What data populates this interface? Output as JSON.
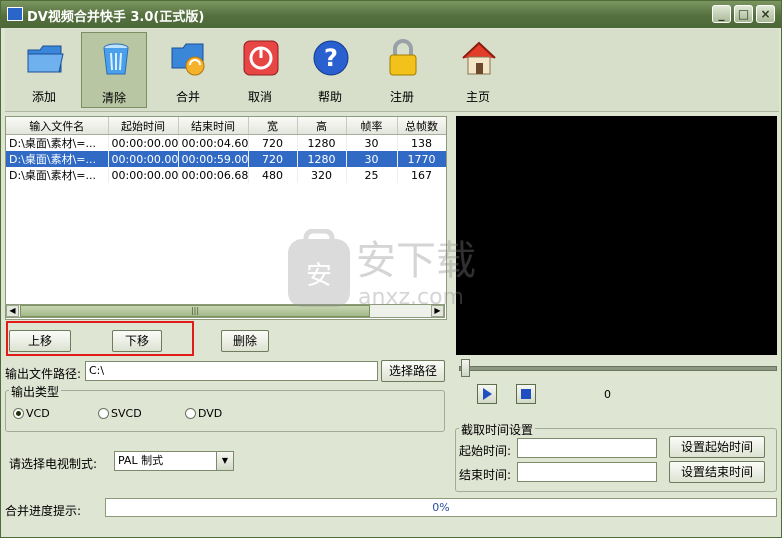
{
  "window": {
    "title": "DV视频合并快手 3.0(正式版)",
    "min": "_",
    "max": "□",
    "close": "×"
  },
  "toolbar": [
    {
      "label": "添加"
    },
    {
      "label": "清除"
    },
    {
      "label": "合并"
    },
    {
      "label": "取消"
    },
    {
      "label": "帮助"
    },
    {
      "label": "注册"
    },
    {
      "label": "主页"
    }
  ],
  "table": {
    "columns": [
      "输入文件名",
      "起始时间",
      "结束时间",
      "宽",
      "高",
      "帧率",
      "总帧数"
    ],
    "rows": [
      [
        "D:\\桌面\\素材\\=...",
        "00:00:00.00",
        "00:00:04.60",
        "720",
        "1280",
        "30",
        "138"
      ],
      [
        "D:\\桌面\\素材\\=...",
        "00:00:00.00",
        "00:00:59.00",
        "720",
        "1280",
        "30",
        "1770"
      ],
      [
        "D:\\桌面\\素材\\=...",
        "00:00:00.00",
        "00:00:06.68",
        "480",
        "320",
        "25",
        "167"
      ]
    ],
    "selected_row": 1
  },
  "buttons": {
    "up": "上移",
    "down": "下移",
    "delete": "删除",
    "choose_path": "选择路径",
    "set_start": "设置起始时间",
    "set_end": "设置结束时间"
  },
  "output": {
    "path_label": "输出文件路径:",
    "path_value": "C:\\"
  },
  "output_type": {
    "label": "输出类型",
    "options": [
      "VCD",
      "SVCD",
      "DVD"
    ],
    "selected": "VCD"
  },
  "tv": {
    "label": "请选择电视制式:",
    "value": "PAL 制式"
  },
  "player": {
    "counter": "0"
  },
  "cut": {
    "group_label": "截取时间设置",
    "start_label": "起始时间:",
    "end_label": "结束时间:",
    "start_value": "",
    "end_value": ""
  },
  "progress": {
    "label": "合并进度提示:",
    "value": "0%"
  },
  "watermark": {
    "text": "安下载",
    "sub": "anxz.com"
  },
  "colors": {
    "titlebar": "#55703f",
    "selection": "#316ac5",
    "highlight_box": "#e21b1b"
  }
}
